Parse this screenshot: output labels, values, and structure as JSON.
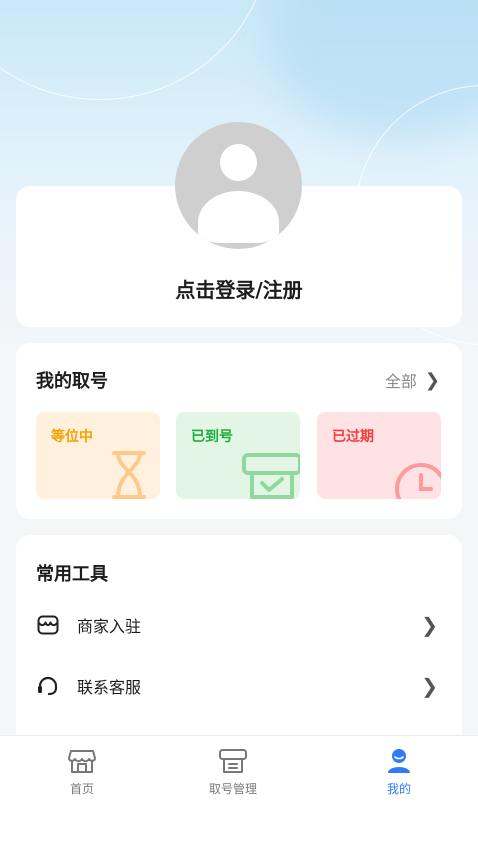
{
  "profile": {
    "login_text": "点击登录/注册",
    "avatar_icon": "default-user-avatar"
  },
  "my_queue": {
    "title": "我的取号",
    "all_link": "全部",
    "statuses": [
      {
        "label": "等位中",
        "icon": "hourglass-icon",
        "color": "#f6a100"
      },
      {
        "label": "已到号",
        "icon": "ticket-machine-icon",
        "color": "#1ead3c"
      },
      {
        "label": "已过期",
        "icon": "clock-icon",
        "color": "#f23d3d"
      }
    ]
  },
  "tools": {
    "title": "常用工具",
    "items": [
      {
        "label": "商家入驻",
        "icon": "shop-icon"
      },
      {
        "label": "联系客服",
        "icon": "headset-icon"
      }
    ]
  },
  "tabbar": {
    "items": [
      {
        "label": "首页",
        "icon": "store-icon",
        "active": false
      },
      {
        "label": "取号管理",
        "icon": "ticket-machine-icon",
        "active": false
      },
      {
        "label": "我的",
        "icon": "user-icon",
        "active": true
      }
    ],
    "active_color": "#2f7cf6"
  }
}
